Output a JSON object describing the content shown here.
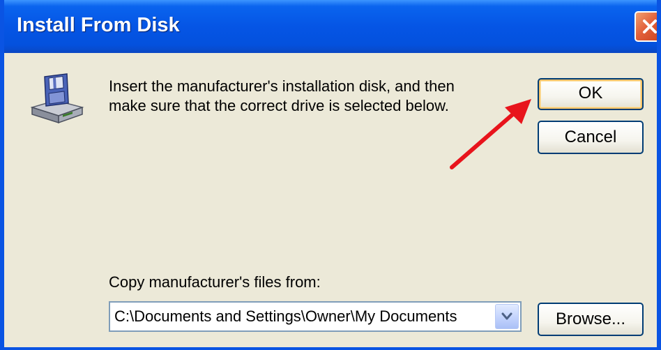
{
  "window": {
    "title": "Install From Disk"
  },
  "titlebar": {
    "close_icon": "close-icon"
  },
  "dialog": {
    "icon": "floppy-disk-drive-icon",
    "prompt_lines": [
      "Insert the manufacturer's installation disk, and then",
      "make sure that the correct drive is selected below."
    ],
    "copy_label": "Copy manufacturer's files from:",
    "path_value": "C:\\Documents and Settings\\Owner\\My Documents",
    "dropdown_icon": "chevron-down-icon",
    "annotation_icon": "red-arrow-icon"
  },
  "buttons": {
    "ok": "OK",
    "cancel": "Cancel",
    "browse": "Browse..."
  },
  "colors": {
    "titlebar": "#0555e5",
    "window_bg": "#ece9d8",
    "close_button": "#e2603a",
    "button_border": "#003c74",
    "default_button_highlight": "#f7c469",
    "annotation_arrow": "#e8141c"
  }
}
